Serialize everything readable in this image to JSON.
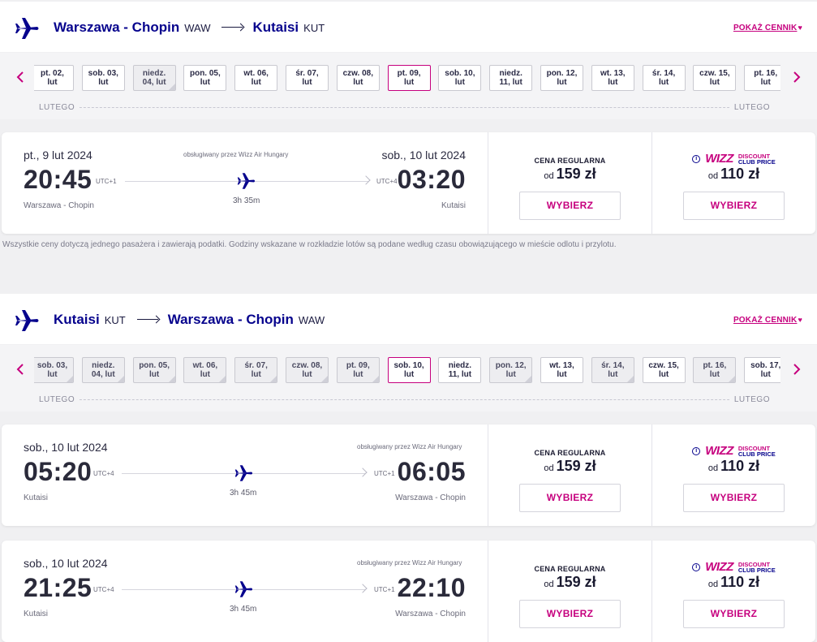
{
  "outbound": {
    "origin_city": "Warszawa - Chopin",
    "origin_code": "WAW",
    "dest_city": "Kutaisi",
    "dest_code": "KUT",
    "price_link": "POKAŻ CENNIK",
    "dates": [
      {
        "l1": "pt. 02,",
        "l2": "lut",
        "state": "normal"
      },
      {
        "l1": "sob. 03,",
        "l2": "lut",
        "state": "normal"
      },
      {
        "l1": "niedz.",
        "l2": "04, lut",
        "state": "dim"
      },
      {
        "l1": "pon. 05,",
        "l2": "lut",
        "state": "normal"
      },
      {
        "l1": "wt. 06,",
        "l2": "lut",
        "state": "normal"
      },
      {
        "l1": "śr. 07,",
        "l2": "lut",
        "state": "normal"
      },
      {
        "l1": "czw. 08,",
        "l2": "lut",
        "state": "normal"
      },
      {
        "l1": "pt. 09,",
        "l2": "lut",
        "state": "selected"
      },
      {
        "l1": "sob. 10,",
        "l2": "lut",
        "state": "normal"
      },
      {
        "l1": "niedz.",
        "l2": "11, lut",
        "state": "normal"
      },
      {
        "l1": "pon. 12,",
        "l2": "lut",
        "state": "normal"
      },
      {
        "l1": "wt. 13,",
        "l2": "lut",
        "state": "normal"
      },
      {
        "l1": "śr. 14,",
        "l2": "lut",
        "state": "normal"
      },
      {
        "l1": "czw. 15,",
        "l2": "lut",
        "state": "normal"
      },
      {
        "l1": "pt. 16,",
        "l2": "lut",
        "state": "normal"
      }
    ],
    "month_left": "LUTEGO",
    "month_right": "LUTEGO",
    "flights": [
      {
        "dep_date": "pt., 9 lut 2024",
        "arr_date": "sob., 10 lut 2024",
        "dep_time": "20:45",
        "arr_time": "03:20",
        "dep_utc": "UTC+1",
        "arr_utc": "UTC+4",
        "operator": "obsługiwany przez Wizz Air Hungary",
        "duration": "3h 35m",
        "dep_city": "Warszawa - Chopin",
        "arr_city": "Kutaisi",
        "reg_label": "CENA REGULARNA",
        "od": "od",
        "reg_price": "159 zł",
        "club_price": "110 zł",
        "select_label": "WYBIERZ"
      }
    ]
  },
  "disclaimer": "Wszystkie ceny dotyczą jednego pasażera i zawierają podatki. Godziny wskazane w rozkładzie lotów są podane według czasu obowiązującego w mieście odlotu i przylotu.",
  "inbound": {
    "origin_city": "Kutaisi",
    "origin_code": "KUT",
    "dest_city": "Warszawa - Chopin",
    "dest_code": "WAW",
    "price_link": "POKAŻ CENNIK",
    "dates": [
      {
        "l1": "sob. 03,",
        "l2": "lut",
        "state": "dim"
      },
      {
        "l1": "niedz.",
        "l2": "04, lut",
        "state": "dim"
      },
      {
        "l1": "pon. 05,",
        "l2": "lut",
        "state": "dim"
      },
      {
        "l1": "wt. 06,",
        "l2": "lut",
        "state": "dim"
      },
      {
        "l1": "śr. 07,",
        "l2": "lut",
        "state": "dim"
      },
      {
        "l1": "czw. 08,",
        "l2": "lut",
        "state": "dim"
      },
      {
        "l1": "pt. 09,",
        "l2": "lut",
        "state": "dim"
      },
      {
        "l1": "sob. 10,",
        "l2": "lut",
        "state": "selected"
      },
      {
        "l1": "niedz.",
        "l2": "11, lut",
        "state": "normal"
      },
      {
        "l1": "pon. 12,",
        "l2": "lut",
        "state": "dim"
      },
      {
        "l1": "wt. 13,",
        "l2": "lut",
        "state": "normal"
      },
      {
        "l1": "śr. 14,",
        "l2": "lut",
        "state": "dim"
      },
      {
        "l1": "czw. 15,",
        "l2": "lut",
        "state": "normal"
      },
      {
        "l1": "pt. 16,",
        "l2": "lut",
        "state": "dim"
      },
      {
        "l1": "sob. 17,",
        "l2": "lut",
        "state": "normal"
      }
    ],
    "month_left": "LUTEGO",
    "month_right": "LUTEGO",
    "flights": [
      {
        "dep_date": "sob., 10 lut 2024",
        "dep_time": "05:20",
        "arr_time": "06:05",
        "dep_utc": "UTC+4",
        "arr_utc": "UTC+1",
        "operator": "obsługiwany przez Wizz Air Hungary",
        "duration": "3h 45m",
        "dep_city": "Kutaisi",
        "arr_city": "Warszawa - Chopin",
        "reg_label": "CENA REGULARNA",
        "od": "od",
        "reg_price": "159 zł",
        "club_price": "110 zł",
        "select_label": "WYBIERZ"
      },
      {
        "dep_date": "sob., 10 lut 2024",
        "dep_time": "21:25",
        "arr_time": "22:10",
        "dep_utc": "UTC+4",
        "arr_utc": "UTC+1",
        "operator": "obsługiwany przez Wizz Air Hungary",
        "duration": "3h 45m",
        "dep_city": "Kutaisi",
        "arr_city": "Warszawa - Chopin",
        "reg_label": "CENA REGULARNA",
        "od": "od",
        "reg_price": "159 zł",
        "club_price": "110 zł",
        "select_label": "WYBIERZ"
      }
    ]
  },
  "club_logo": {
    "brand": "WIZZ",
    "line1": "DISCOUNT",
    "line2": "CLUB",
    "line3": "PRICE"
  },
  "colors": {
    "primary": "#06038d",
    "accent": "#c6007e",
    "bg": "#f0f0f2"
  },
  "icons": {
    "header_plane": "plane-icon",
    "nav_prev": "chevron-left-icon",
    "nav_next": "chevron-right-icon",
    "info": "info-icon",
    "heart": "heart-icon"
  }
}
